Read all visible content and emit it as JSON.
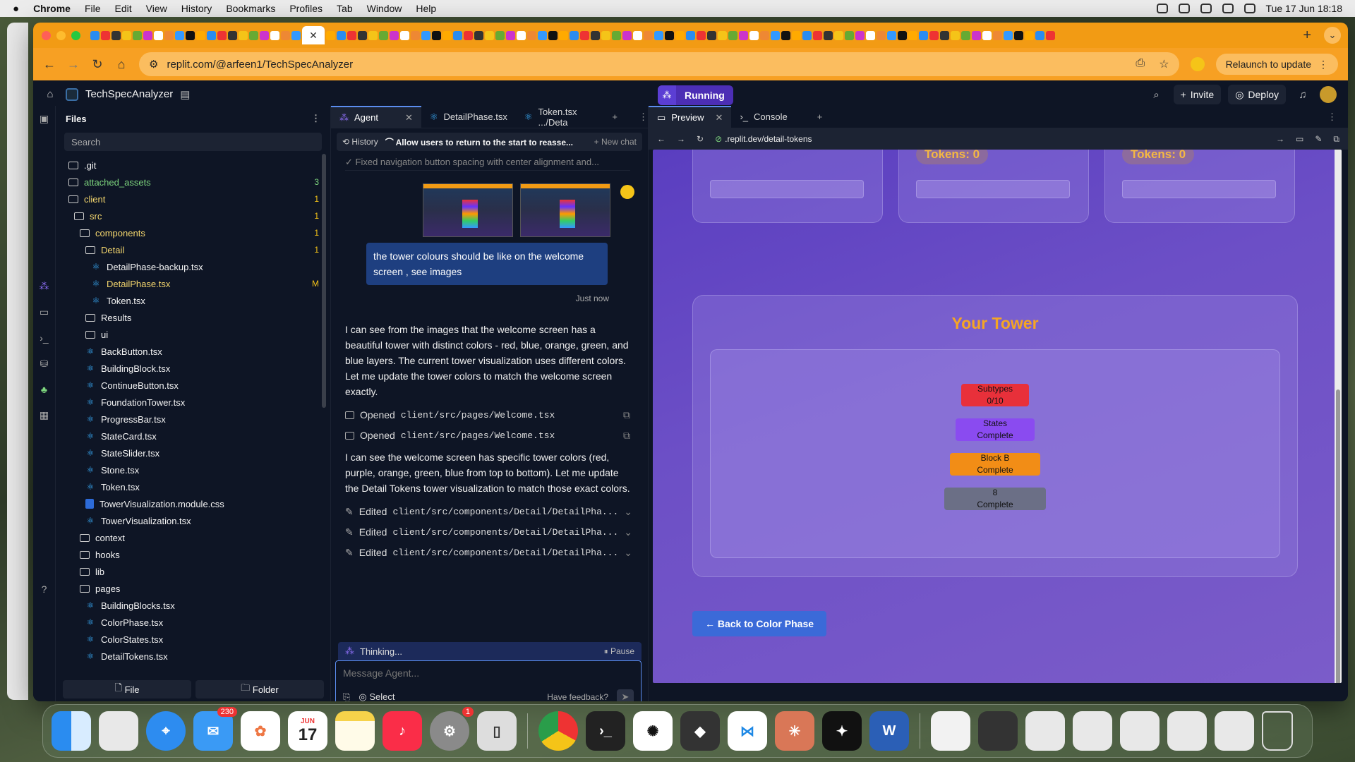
{
  "menubar": {
    "app": "Chrome",
    "items": [
      "File",
      "Edit",
      "View",
      "History",
      "Bookmarks",
      "Profiles",
      "Tab",
      "Window",
      "Help"
    ],
    "datetime": "Tue 17 Jun  18:18"
  },
  "browser": {
    "url": "replit.com/@arfeen1/TechSpecAnalyzer",
    "relaunch": "Relaunch to update"
  },
  "replit": {
    "project": "TechSpecAnalyzer",
    "run_label": "Running",
    "invite": "Invite",
    "deploy": "Deploy"
  },
  "files": {
    "title": "Files",
    "search_placeholder": "Search",
    "tree": [
      {
        "name": ".git",
        "type": "folder",
        "indent": 0
      },
      {
        "name": "attached_assets",
        "type": "folder",
        "indent": 0,
        "badge": "3",
        "color": "green"
      },
      {
        "name": "client",
        "type": "folder",
        "indent": 0,
        "badge": "1",
        "color": "yellow"
      },
      {
        "name": "src",
        "type": "folder",
        "indent": 1,
        "badge": "1",
        "color": "yellow"
      },
      {
        "name": "components",
        "type": "folder",
        "indent": 2,
        "badge": "1",
        "color": "yellow"
      },
      {
        "name": "Detail",
        "type": "folder",
        "indent": 3,
        "badge": "1",
        "color": "yellow"
      },
      {
        "name": "DetailPhase-backup.tsx",
        "type": "file",
        "indent": 4
      },
      {
        "name": "DetailPhase.tsx",
        "type": "file",
        "indent": 4,
        "badge": "M",
        "color": "yellow"
      },
      {
        "name": "Token.tsx",
        "type": "file",
        "indent": 4
      },
      {
        "name": "Results",
        "type": "folder",
        "indent": 3
      },
      {
        "name": "ui",
        "type": "folder",
        "indent": 3
      },
      {
        "name": "BackButton.tsx",
        "type": "file",
        "indent": 3
      },
      {
        "name": "BuildingBlock.tsx",
        "type": "file",
        "indent": 3
      },
      {
        "name": "ContinueButton.tsx",
        "type": "file",
        "indent": 3
      },
      {
        "name": "FoundationTower.tsx",
        "type": "file",
        "indent": 3
      },
      {
        "name": "ProgressBar.tsx",
        "type": "file",
        "indent": 3
      },
      {
        "name": "StateCard.tsx",
        "type": "file",
        "indent": 3
      },
      {
        "name": "StateSlider.tsx",
        "type": "file",
        "indent": 3
      },
      {
        "name": "Stone.tsx",
        "type": "file",
        "indent": 3
      },
      {
        "name": "Token.tsx",
        "type": "file",
        "indent": 3
      },
      {
        "name": "TowerVisualization.module.css",
        "type": "css",
        "indent": 3
      },
      {
        "name": "TowerVisualization.tsx",
        "type": "file",
        "indent": 3
      },
      {
        "name": "context",
        "type": "folder",
        "indent": 2
      },
      {
        "name": "hooks",
        "type": "folder",
        "indent": 2
      },
      {
        "name": "lib",
        "type": "folder",
        "indent": 2
      },
      {
        "name": "pages",
        "type": "folder",
        "indent": 2
      },
      {
        "name": "BuildingBlocks.tsx",
        "type": "file",
        "indent": 3
      },
      {
        "name": "ColorPhase.tsx",
        "type": "file",
        "indent": 3
      },
      {
        "name": "ColorStates.tsx",
        "type": "file",
        "indent": 3
      },
      {
        "name": "DetailTokens.tsx",
        "type": "file",
        "indent": 3
      }
    ],
    "new_file": "File",
    "new_folder": "Folder"
  },
  "agent": {
    "tabs": [
      {
        "label": "Agent",
        "active": true
      },
      {
        "label": "DetailPhase.tsx"
      },
      {
        "label": "Token.tsx  .../Deta"
      }
    ],
    "history": "History",
    "thread_title": "Allow users to return to the start to reasse...",
    "new_chat": "New chat",
    "faded_line": "✓ Fixed navigation button spacing with center alignment and...",
    "user_message": "the tower colours should be like on the welcome screen , see images",
    "user_time": "Just now",
    "reply1": "I can see from the images that the welcome screen has a beautiful tower with distinct colors - red, blue, orange, green, and blue layers. The current tower visualization uses different colors. Let me update the tower colors to match the welcome screen exactly.",
    "opened": [
      "client/src/pages/Welcome.tsx",
      "client/src/pages/Welcome.tsx"
    ],
    "opened_label": "Opened",
    "reply2": "I can see the welcome screen has specific tower colors (red, purple, orange, green, blue from top to bottom). Let me update the Detail Tokens tower visualization to match those exact colors.",
    "edited_label": "Edited",
    "edited": [
      "client/src/components/Detail/DetailPha...",
      "client/src/components/Detail/DetailPha...",
      "client/src/components/Detail/DetailPha..."
    ],
    "thinking": "Thinking...",
    "pause": "Pause",
    "input_placeholder": "Message Agent...",
    "select": "Select",
    "feedback": "Have feedback?"
  },
  "preview": {
    "tabs": [
      {
        "label": "Preview",
        "active": true
      },
      {
        "label": "Console"
      }
    ],
    "url_host": ".replit.dev",
    "url_path": "/detail-tokens",
    "tokens_label": "Tokens: 0",
    "tower_title": "Your Tower",
    "layers": [
      {
        "line1": "Subtypes",
        "line2": "0/10",
        "color": "#e8303a"
      },
      {
        "line1": "States",
        "line2": "Complete",
        "color": "#8a4bf0"
      },
      {
        "line1": "Block B",
        "line2": "Complete",
        "color": "#f28d16"
      },
      {
        "line1": "8",
        "line2": "Complete",
        "color": "#6b6f86"
      }
    ],
    "back_button": "← Back to Color Phase"
  },
  "dock": {
    "mail_badge": "230",
    "settings_badge": "1",
    "calendar_month": "JUN",
    "calendar_day": "17"
  }
}
